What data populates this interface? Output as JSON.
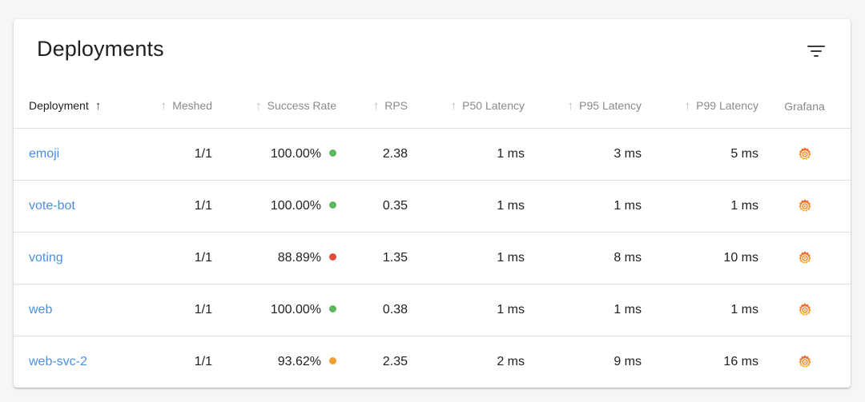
{
  "title": "Deployments",
  "filter_icon": "filter-list-icon",
  "columns": [
    {
      "label": "Deployment",
      "sort": "active-asc"
    },
    {
      "label": "Meshed",
      "sort": "inactive"
    },
    {
      "label": "Success Rate",
      "sort": "inactive"
    },
    {
      "label": "RPS",
      "sort": "inactive"
    },
    {
      "label": "P50 Latency",
      "sort": "inactive"
    },
    {
      "label": "P95 Latency",
      "sort": "inactive"
    },
    {
      "label": "P99 Latency",
      "sort": "inactive"
    },
    {
      "label": "Grafana",
      "sort": "none"
    }
  ],
  "status_colors": {
    "good": "#5cb85c",
    "warning": "#f0a030",
    "bad": "#e24b3b"
  },
  "link_color": "#4a90e2",
  "rows": [
    {
      "deployment": "emoji",
      "meshed": "1/1",
      "success_rate": "100.00%",
      "status": "good",
      "rps": "2.38",
      "p50": "1 ms",
      "p95": "3 ms",
      "p99": "5 ms",
      "grafana_icon": "grafana-icon"
    },
    {
      "deployment": "vote-bot",
      "meshed": "1/1",
      "success_rate": "100.00%",
      "status": "good",
      "rps": "0.35",
      "p50": "1 ms",
      "p95": "1 ms",
      "p99": "1 ms",
      "grafana_icon": "grafana-icon"
    },
    {
      "deployment": "voting",
      "meshed": "1/1",
      "success_rate": "88.89%",
      "status": "bad",
      "rps": "1.35",
      "p50": "1 ms",
      "p95": "8 ms",
      "p99": "10 ms",
      "grafana_icon": "grafana-icon"
    },
    {
      "deployment": "web",
      "meshed": "1/1",
      "success_rate": "100.00%",
      "status": "good",
      "rps": "0.38",
      "p50": "1 ms",
      "p95": "1 ms",
      "p99": "1 ms",
      "grafana_icon": "grafana-icon"
    },
    {
      "deployment": "web-svc-2",
      "meshed": "1/1",
      "success_rate": "93.62%",
      "status": "warning",
      "rps": "2.35",
      "p50": "2 ms",
      "p95": "9 ms",
      "p99": "16 ms",
      "grafana_icon": "grafana-icon"
    }
  ]
}
